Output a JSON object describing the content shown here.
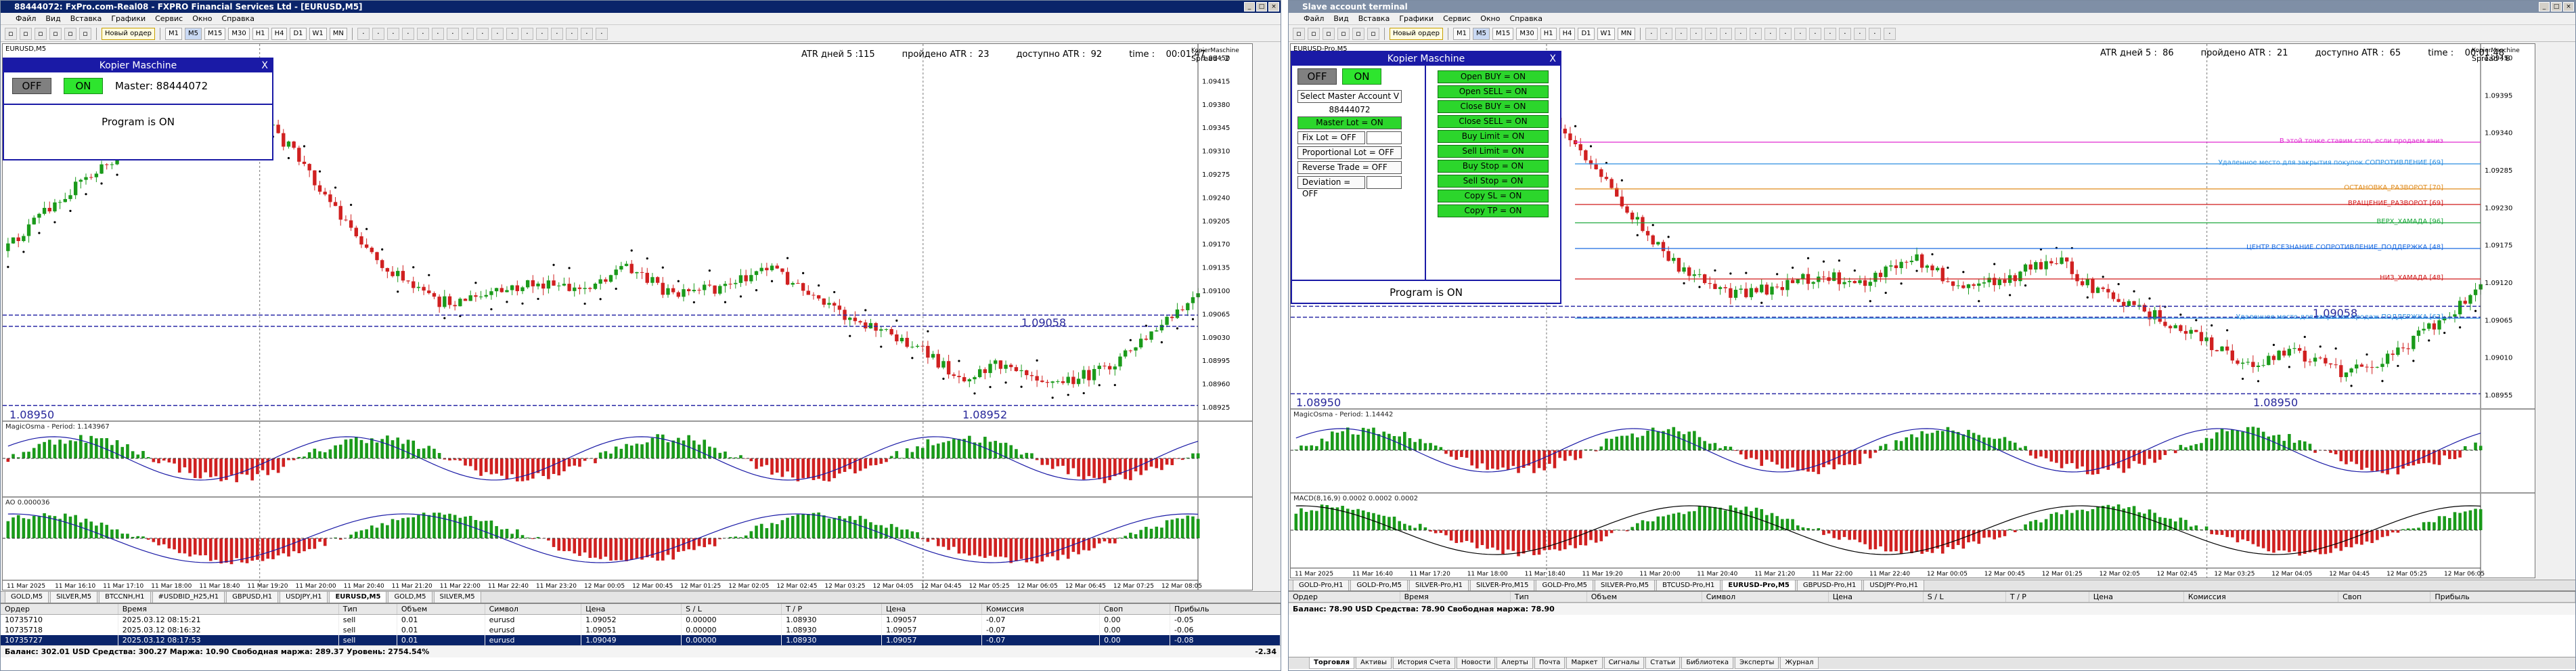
{
  "left": {
    "title": "88444072: FxPro.com-Real08 - FXPRO Financial Services Ltd - [EURUSD,M5]",
    "menu": [
      "Файл",
      "Вид",
      "Вставка",
      "Графики",
      "Сервис",
      "Окно",
      "Справка"
    ],
    "new_order": "Новый ордер",
    "timeframes": [
      "M1",
      "M5",
      "M15",
      "M30",
      "H1",
      "H4",
      "D1",
      "W1",
      "MN"
    ],
    "active_timeframe": "M5",
    "symbol_label": "EURUSD,M5",
    "atr_days": "ATR дней 5 :115",
    "atr_passed": "пройдено ATR :  23",
    "atr_available": "доступно ATR :  92",
    "time": "time :    00:01:47",
    "spread_name": "KopierMaschine",
    "spread": "Spread :    2",
    "low_price": "1.08950",
    "mid_price": "1.08952",
    "last_price": "1.09058",
    "ind1_label": "MagicOsma - Period: 1.143967",
    "ind2_label": "AO 0.000036",
    "price_axis": [
      "1.09450",
      "1.09415",
      "1.09380",
      "1.09345",
      "1.09310",
      "1.09275",
      "1.09240",
      "1.09205",
      "1.09170",
      "1.09135",
      "1.09100",
      "1.09065",
      "1.09030",
      "1.08995",
      "1.08960",
      "1.08925"
    ],
    "time_axis": [
      "11 Mar 2025",
      "11 Mar 16:10",
      "11 Mar 17:10",
      "11 Mar 18:00",
      "11 Mar 18:40",
      "11 Mar 19:20",
      "11 Mar 20:00",
      "11 Mar 20:40",
      "11 Mar 21:20",
      "11 Mar 22:00",
      "11 Mar 22:40",
      "11 Mar 23:20",
      "12 Mar 00:05",
      "12 Mar 00:45",
      "12 Mar 01:25",
      "12 Mar 02:05",
      "12 Mar 02:45",
      "12 Mar 03:25",
      "12 Mar 04:05",
      "12 Mar 04:45",
      "12 Mar 05:25",
      "12 Mar 06:05",
      "12 Mar 06:45",
      "12 Mar 07:25",
      "12 Mar 08:05"
    ],
    "chart_tabs": [
      "GOLD,M5",
      "SILVER,M5",
      "BTCCNH,H1",
      "#USDBID_H25,H1",
      "GBPUSD,H1",
      "USDJPY,H1",
      "EURUSD,M5",
      "GOLD,M5",
      "SILVER,M5"
    ],
    "active_chart_tab": "EURUSD,M5",
    "orders": {
      "headers": [
        "Ордер",
        "Время",
        "Тип",
        "Объем",
        "Символ",
        "Цена",
        "S / L",
        "T / P",
        "Цена",
        "Комиссия",
        "Своп",
        "Прибыль"
      ],
      "rows": [
        [
          "10735710",
          "2025.03.12 08:15:21",
          "sell",
          "0.01",
          "eurusd",
          "1.09052",
          "0.00000",
          "1.08930",
          "1.09057",
          "-0.07",
          "0.00",
          "-0.05"
        ],
        [
          "10735718",
          "2025.03.12 08:16:32",
          "sell",
          "0.01",
          "eurusd",
          "1.09051",
          "0.00000",
          "1.08930",
          "1.09057",
          "-0.07",
          "0.00",
          "-0.06"
        ],
        [
          "10735727",
          "2025.03.12 08:17:53",
          "sell",
          "0.01",
          "eurusd",
          "1.09049",
          "0.00000",
          "1.08930",
          "1.09057",
          "-0.07",
          "0.00",
          "-0.08"
        ]
      ],
      "balance": "Баланс: 302.01 USD  Средства: 300.27  Маржа: 10.90  Свободная маржа: 289.37  Уровень: 2754.54%",
      "total": "-2.34"
    },
    "panel": {
      "title": "Kopier Maschine",
      "off": "OFF",
      "on": "ON",
      "master": "Master: 88444072",
      "status": "Program is ON"
    }
  },
  "right": {
    "title": "Slave account terminal",
    "menu": [
      "Файл",
      "Вид",
      "Вставка",
      "Графики",
      "Сервис",
      "Окно",
      "Справка"
    ],
    "new_order": "Новый ордер",
    "timeframes": [
      "M1",
      "M5",
      "M15",
      "M30",
      "H1",
      "H4",
      "D1",
      "W1",
      "MN"
    ],
    "active_timeframe": "M5",
    "symbol_label": "EURUSD-Pro,M5",
    "atr_days": "ATR дней 5 :  86",
    "atr_passed": "пройдено ATR :  21",
    "atr_available": "доступно ATR :  65",
    "time": "time :    00:01:48",
    "spread_name": "KopierMaschine",
    "spread": "Spread :    6",
    "low_price": "1.08950",
    "mid_price": "1.08950",
    "last_price": "1.09058",
    "ind1_label": "MagicOsma - Period: 1.14442",
    "ind2_label": "MACD(8,16,9) 0.0002 0.0002 0.0002",
    "levels": [
      {
        "text": "В этой точке ставим стоп, если продаем вниз",
        "color": "#e02ad0"
      },
      {
        "text": "Удаленное место для закрытия покупок СОПРОТИВЛЕНИЕ [69]",
        "color": "#2a8ee0"
      },
      {
        "text": "ОСТАНОВКА_РАЗВОРОТ [70]",
        "color": "#e08a1a"
      },
      {
        "text": "ВРАЩЕНИЕ_РАЗВОРОТ [69]",
        "color": "#d01a1a"
      },
      {
        "text": "ВЕРХ_ХАМАДА [96]",
        "color": "#1aa63a"
      },
      {
        "text": "ЦЕНТР ВСЕЗНАНИЕ СОПРОТИВЛЕНИЕ_ПОДДЕРЖКА [48]",
        "color": "#1a6ae0"
      },
      {
        "text": "НИЗ_ХАМАДА [48]",
        "color": "#d01a1a"
      },
      {
        "text": "Удаленное место для закрытия продаж ПОДДЕРЖКА [62]",
        "color": "#2a8ee0"
      }
    ],
    "price_axis": [
      "1.09450",
      "1.09395",
      "1.09340",
      "1.09285",
      "1.09230",
      "1.09175",
      "1.09120",
      "1.09065",
      "1.09010",
      "1.08955"
    ],
    "time_axis": [
      "11 Mar 2025",
      "11 Mar 16:40",
      "11 Mar 17:20",
      "11 Mar 18:00",
      "11 Mar 18:40",
      "11 Mar 19:20",
      "11 Mar 20:00",
      "11 Mar 20:40",
      "11 Mar 21:20",
      "11 Mar 22:00",
      "11 Mar 22:40",
      "12 Mar 00:05",
      "12 Mar 00:45",
      "12 Mar 01:25",
      "12 Mar 02:05",
      "12 Mar 02:45",
      "12 Mar 03:25",
      "12 Mar 04:05",
      "12 Mar 04:45",
      "12 Mar 05:25",
      "12 Mar 06:05"
    ],
    "chart_tabs": [
      "GOLD-Pro,H1",
      "GOLD-Pro,M5",
      "SILVER-Pro,H1",
      "SILVER-Pro,M15",
      "GOLD-Pro,M5",
      "SILVER-Pro,M5",
      "BTCUSD-Pro,H1",
      "EURUSD-Pro,M5",
      "GBPUSD-Pro,H1",
      "USDJPY-Pro,H1"
    ],
    "active_chart_tab": "EURUSD-Pro,M5",
    "orders": {
      "headers": [
        "Ордер",
        "Время",
        "Тип",
        "Объем",
        "Символ",
        "Цена",
        "S / L",
        "T / P",
        "Цена",
        "Комиссия",
        "Своп",
        "Прибыль"
      ],
      "balance": "Баланс: 78.90 USD  Средства: 78.90  Свободная маржа: 78.90"
    },
    "bottom_tabs": [
      "Торговля",
      "Активы",
      "История Счета",
      "Новости",
      "Алерты",
      "Почта",
      "Маркет",
      "Сигналы",
      "Статьи",
      "Библиотека",
      "Эксперты",
      "Журнал"
    ],
    "panel": {
      "title": "Kopier Maschine",
      "off": "OFF",
      "on": "ON",
      "select": "Select Master Account V",
      "account": "88444072",
      "master_lot": "Master Lot = ON",
      "fix_lot": "Fix Lot = OFF",
      "prop_lot": "Proportional Lot = OFF",
      "reverse": "Reverse Trade = OFF",
      "deviation": "Deviation = OFF",
      "right_buttons": [
        "Open BUY = ON",
        "Open SELL = ON",
        "Close BUY = ON",
        "Close SELL = ON",
        "Buy Limit = ON",
        "Sell Limit = ON",
        "Buy Stop = ON",
        "Sell Stop = ON",
        "Copy SL = ON",
        "Copy TP = ON"
      ],
      "status": "Program is ON"
    }
  }
}
